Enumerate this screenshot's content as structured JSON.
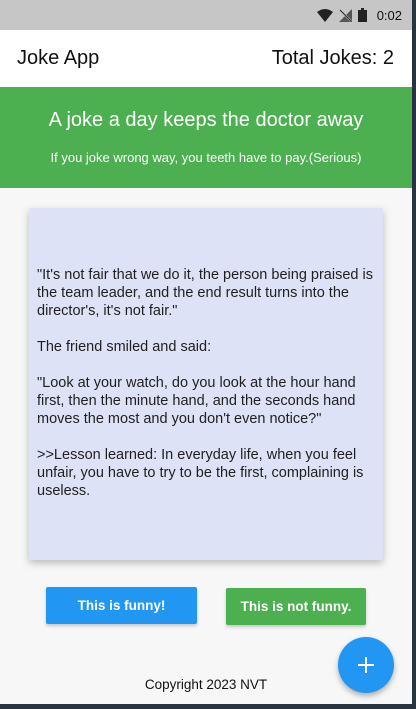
{
  "status_bar": {
    "time": "0:02",
    "icons": [
      "wifi-icon",
      "no-signal-icon",
      "battery-icon"
    ]
  },
  "app_bar": {
    "title": "Joke App",
    "total_jokes": "Total Jokes: 2"
  },
  "hero": {
    "title": "A joke a day keeps the doctor away",
    "subtitle": "If you joke wrong way, you teeth have to pay.(Serious)"
  },
  "joke": {
    "text": "\"It's not fair that we do it, the person being praised is the team leader, and the end result turns into the director's, it's not fair.\"\n\nThe friend smiled and said:\n\n\"Look at your watch, do you look at the hour hand first, then the minute hand, and the seconds hand moves the most and you don't even notice?\"\n\n>>Lesson learned: In everyday life, when you feel unfair, you have to try to be the first, complaining is useless."
  },
  "buttons": {
    "funny": "This is funny!",
    "not_funny": "This is not funny."
  },
  "footer": {
    "copyright": "Copyright 2023 NVT"
  },
  "fab": {
    "icon": "add-icon"
  },
  "colors": {
    "primary_green": "#4caf50",
    "primary_blue": "#2196f3",
    "card_background": "#dee2f6",
    "status_bar": "#c6c6c6"
  }
}
